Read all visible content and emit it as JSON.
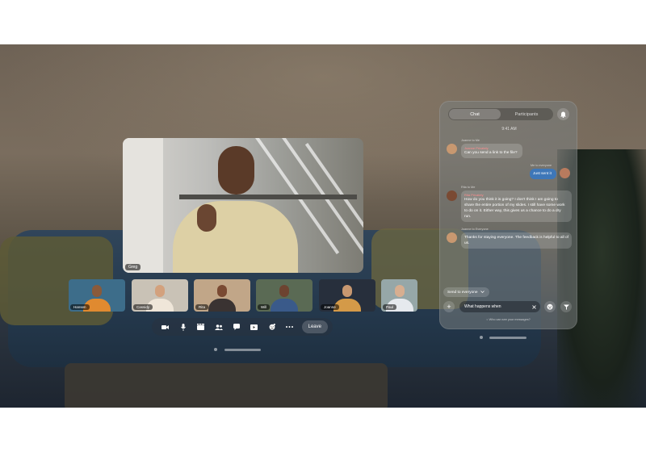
{
  "main_video": {
    "participant_name": "Greg"
  },
  "thumbnails": [
    {
      "name": "Hansen",
      "bg": "#3d6d8a",
      "skin": "#8a5a3b",
      "shirt": "#e08a30"
    },
    {
      "name": "Cassidy",
      "bg": "#c9c2b6",
      "skin": "#d3a17d",
      "shirt": "#efe6d9"
    },
    {
      "name": "Rita",
      "bg": "#c1a688",
      "skin": "#7a4a33",
      "shirt": "#3a3332"
    },
    {
      "name": "Will",
      "bg": "#5a6a54",
      "skin": "#6d4330",
      "shirt": "#3a5a8a"
    },
    {
      "name": "Joanne",
      "bg": "#272f3c",
      "skin": "#c89870",
      "shirt": "#d49a48"
    },
    {
      "name": "Paul",
      "bg": "#96a7a8",
      "skin": "#d7ae90",
      "shirt": "#e6e9ee"
    }
  ],
  "toolbar": {
    "icons": [
      "video-camera-icon",
      "microphone-icon",
      "clapperboard-icon",
      "people-icon",
      "chat-bubble-icon",
      "share-screen-icon",
      "reactions-icon",
      "more-icon"
    ],
    "leave_label": "Leave"
  },
  "chat": {
    "tabs": [
      {
        "label": "Chat",
        "active": true
      },
      {
        "label": "Participants",
        "active": false
      }
    ],
    "time": "9:41 AM",
    "messages": [
      {
        "meta": "Joanne to Me",
        "sender": "Joanne Privately",
        "text": "Can you send a link to the file?",
        "outgoing": false
      },
      {
        "meta": "Me to everyone",
        "sender": "",
        "text": "Just sent it",
        "outgoing": true
      },
      {
        "meta": "Rita to Me",
        "sender": "Rita Privately",
        "text": "How do you think it is going? I don't think I am going to share the entire portion of my slides. I still have some work to do on it. Either way, this gives us a chance to do a dry run.",
        "outgoing": false
      },
      {
        "meta": "Joanne to Everyone",
        "sender": "",
        "text": "Thanks for staying everyone. The feedback is helpful to all of us.",
        "outgoing": false
      }
    ],
    "send_to_label": "Send to everyone",
    "input_value": "What happens when",
    "privacy_text": "Who can see your messages?"
  },
  "colors": {
    "outgoing_bubble": "#3e77b8",
    "private_sender": "#ff8d8d"
  }
}
